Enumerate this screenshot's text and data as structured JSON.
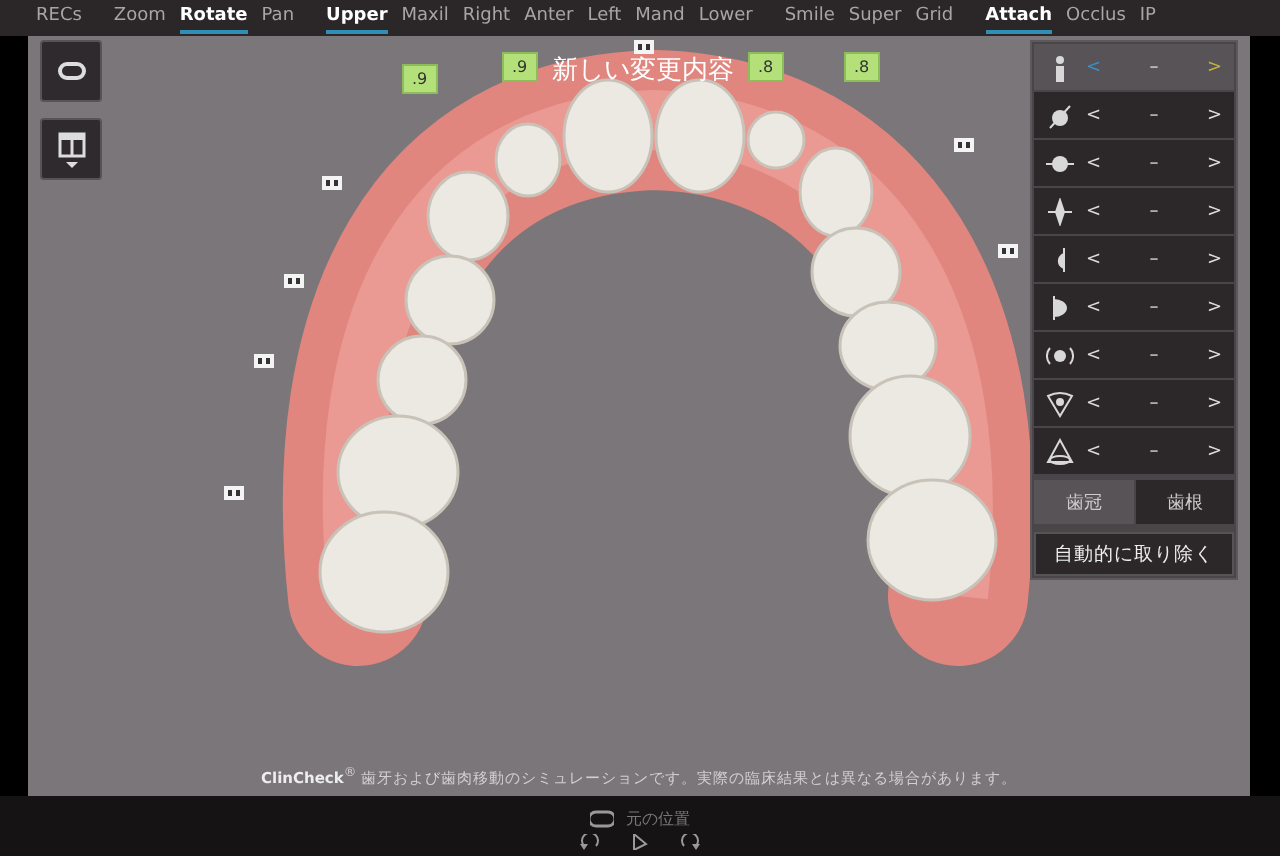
{
  "menu_groups": [
    [
      {
        "label": "RECs",
        "selected": false
      }
    ],
    [
      {
        "label": "Zoom",
        "selected": false
      },
      {
        "label": "Rotate",
        "selected": true
      },
      {
        "label": "Pan",
        "selected": false
      }
    ],
    [
      {
        "label": "Upper",
        "selected": true
      },
      {
        "label": "Maxil",
        "selected": false
      },
      {
        "label": "Right",
        "selected": false
      },
      {
        "label": "Anter",
        "selected": false
      },
      {
        "label": "Left",
        "selected": false
      },
      {
        "label": "Mand",
        "selected": false
      },
      {
        "label": "Lower",
        "selected": false
      }
    ],
    [
      {
        "label": "Smile",
        "selected": false
      },
      {
        "label": "Super",
        "selected": false
      },
      {
        "label": "Grid",
        "selected": false
      }
    ],
    [
      {
        "label": "Attach",
        "selected": true
      },
      {
        "label": "Occlus",
        "selected": false
      },
      {
        "label": "IP",
        "selected": false
      }
    ]
  ],
  "headline": "新しい変更内容",
  "tooth_tags": [
    {
      "label": ".9"
    },
    {
      "label": ".9"
    },
    {
      "label": ".8"
    },
    {
      "label": ".8"
    }
  ],
  "adjust_rows": [
    {
      "prev": "<",
      "value": "–",
      "next": ">",
      "selected": true
    },
    {
      "prev": "<",
      "value": "–",
      "next": ">",
      "selected": false
    },
    {
      "prev": "<",
      "value": "–",
      "next": ">",
      "selected": false
    },
    {
      "prev": "<",
      "value": "–",
      "next": ">",
      "selected": false
    },
    {
      "prev": "<",
      "value": "–",
      "next": ">",
      "selected": false
    },
    {
      "prev": "<",
      "value": "–",
      "next": ">",
      "selected": false
    },
    {
      "prev": "<",
      "value": "–",
      "next": ">",
      "selected": false
    },
    {
      "prev": "<",
      "value": "–",
      "next": ">",
      "selected": false
    },
    {
      "prev": "<",
      "value": "–",
      "next": ">",
      "selected": false
    }
  ],
  "part_tabs": [
    {
      "label": "歯冠",
      "selected": true
    },
    {
      "label": "歯根",
      "selected": false
    }
  ],
  "auto_remove_button": "自動的に取り除く",
  "disclaimer": "**ClinCheck**$^{®}$ 歯牙および歯肉移動のシミュレーションです。実際の臨床結果とは異なる場合があります。",
  "reset_label": "元の位置"
}
